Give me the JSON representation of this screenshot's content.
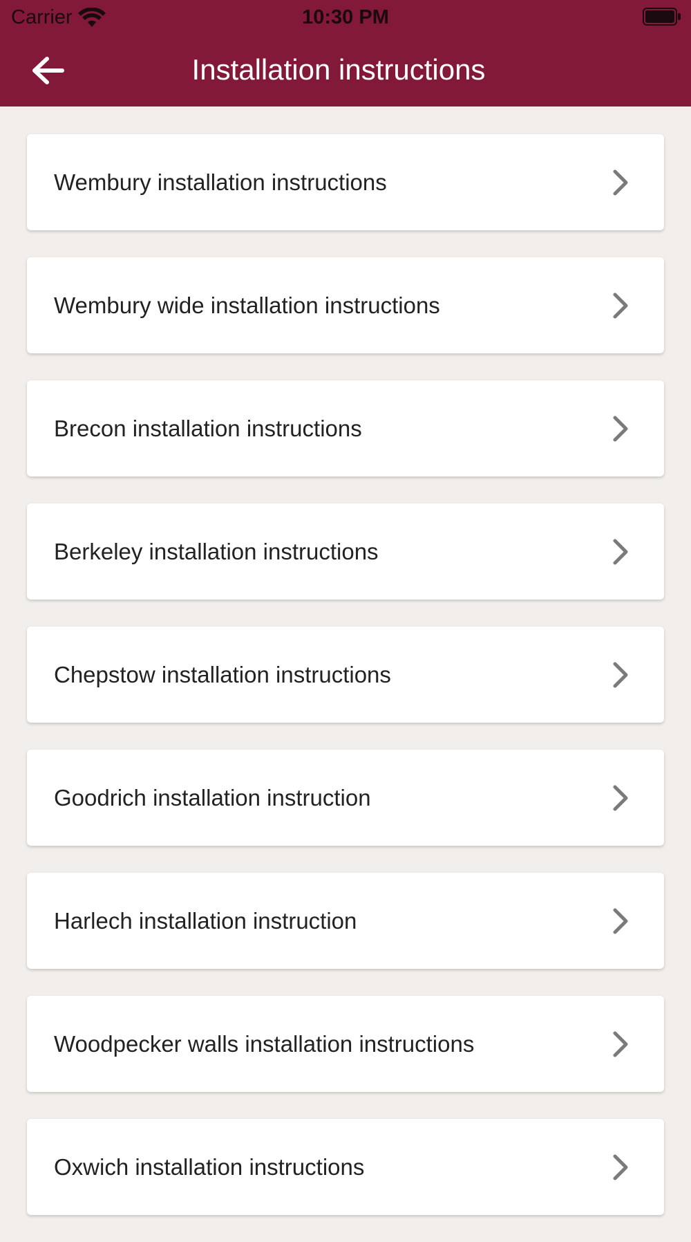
{
  "status_bar": {
    "carrier": "Carrier",
    "time": "10:30 PM",
    "icons": [
      "wifi-icon",
      "battery-icon"
    ]
  },
  "header": {
    "title": "Installation instructions",
    "back_icon": "arrow-left-icon",
    "background_color": "#821939"
  },
  "colors": {
    "page_background": "#f2eeeb",
    "card_background": "#ffffff",
    "chevron": "#7a7a7a"
  },
  "items": [
    {
      "label": "Wembury installation instructions"
    },
    {
      "label": "Wembury wide installation instructions"
    },
    {
      "label": "Brecon installation instructions"
    },
    {
      "label": "Berkeley installation instructions"
    },
    {
      "label": "Chepstow installation instructions"
    },
    {
      "label": "Goodrich installation instruction"
    },
    {
      "label": "Harlech installation instruction"
    },
    {
      "label": "Woodpecker walls installation instructions"
    },
    {
      "label": "Oxwich installation instructions"
    }
  ]
}
